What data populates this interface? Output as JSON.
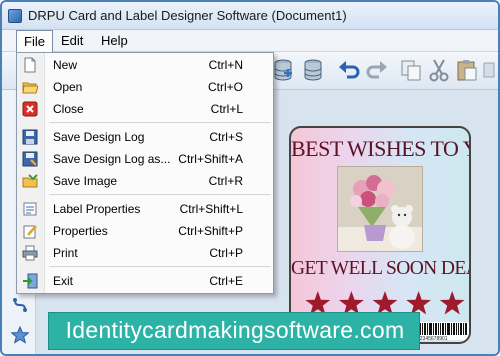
{
  "window": {
    "title": "DRPU Card and Label Designer Software  (Document1)"
  },
  "menubar": {
    "file": "File",
    "edit": "Edit",
    "help": "Help"
  },
  "file_menu": {
    "items": [
      {
        "label": "New",
        "shortcut": "Ctrl+N",
        "icon": "new-document-icon"
      },
      {
        "label": "Open",
        "shortcut": "Ctrl+O",
        "icon": "open-folder-icon"
      },
      {
        "label": "Close",
        "shortcut": "Ctrl+L",
        "icon": "close-red-x-icon"
      },
      {
        "label": "Save Design Log",
        "shortcut": "Ctrl+S",
        "icon": "save-disk-icon"
      },
      {
        "label": "Save Design Log as...",
        "shortcut": "Ctrl+Shift+A",
        "icon": "save-as-disk-icon"
      },
      {
        "label": "Save Image",
        "shortcut": "Ctrl+R",
        "icon": "save-image-folder-icon"
      },
      {
        "label": "Label Properties",
        "shortcut": "Ctrl+Shift+L",
        "icon": "label-properties-icon"
      },
      {
        "label": "Properties",
        "shortcut": "Ctrl+Shift+P",
        "icon": "properties-pencil-icon"
      },
      {
        "label": "Print",
        "shortcut": "Ctrl+P",
        "icon": "printer-icon"
      },
      {
        "label": "Exit",
        "shortcut": "Ctrl+E",
        "icon": "exit-icon"
      }
    ]
  },
  "card": {
    "top_text": "BEST WISHES TO YOU",
    "bottom_text": "GET WELL SOON DEAR",
    "star_count": 5,
    "barcode_number": "12345678901",
    "colors": {
      "text": "#5a1226",
      "star": "#9e1b2e"
    }
  },
  "banner": {
    "text": "Identitycardmakingsoftware.com",
    "color": "#2db3a6"
  },
  "toolbar": {
    "icons": [
      "database-icon",
      "database-icon",
      "undo-icon",
      "redo-icon",
      "copy-icon",
      "cut-icon",
      "paste-icon"
    ]
  }
}
